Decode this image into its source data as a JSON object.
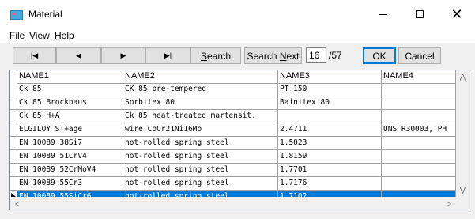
{
  "window": {
    "title": "Material",
    "minimize_icon": "minimize-icon",
    "maximize_icon": "maximize-icon",
    "close_glyph": "✕"
  },
  "menu": {
    "file": {
      "u": "F",
      "rest": "ile"
    },
    "view": {
      "u": "V",
      "rest": "iew"
    },
    "help": {
      "u": "H",
      "rest": "elp"
    }
  },
  "toolbar": {
    "first_glyph": "|◀",
    "prev_glyph": "◀",
    "next_glyph": "▶",
    "last_glyph": "▶|",
    "search": {
      "u": "S",
      "rest": "earch"
    },
    "search_next": {
      "pre": "Search ",
      "u": "N",
      "rest": "ext"
    },
    "record_current": "16",
    "record_total": "/57",
    "ok_label": "OK",
    "cancel_label": "Cancel"
  },
  "grid": {
    "columns": [
      "NAME1",
      "NAME2",
      "NAME3",
      "NAME4"
    ],
    "rows": [
      [
        "Ck 85",
        "CK 85 pre-tempered",
        "PT 150",
        ""
      ],
      [
        "Ck 85 Brockhaus",
        "Sorbitex 80",
        "Bainitex 80",
        ""
      ],
      [
        "Ck 85 H+A",
        "Ck 85 heat-treated martensit.",
        "",
        ""
      ],
      [
        "ELGILOY ST+age",
        "wire CoCr21Ni16Mo",
        "2.4711",
        "UNS R30003, PH"
      ],
      [
        "EN 10089 38Si7",
        "hot-rolled spring steel",
        "1.5023",
        ""
      ],
      [
        "EN 10089 51CrV4",
        "hot-rolled spring steel",
        "1.8159",
        ""
      ],
      [
        "EN 10089 52CrMoV4",
        "hot rolled spring steel",
        "1.7701",
        ""
      ],
      [
        "EN 10089 55Cr3",
        "hot-rolled spring steel",
        "1.7176",
        ""
      ],
      [
        "EN 10089 55SiCr6",
        "hot-rolled spring steel",
        "1.7102",
        ""
      ]
    ],
    "selected_row": 8,
    "selection_color": "#0078d7"
  },
  "scrollbars": {
    "up": "⋀",
    "down": "⋁",
    "left": "<",
    "right": ">"
  }
}
